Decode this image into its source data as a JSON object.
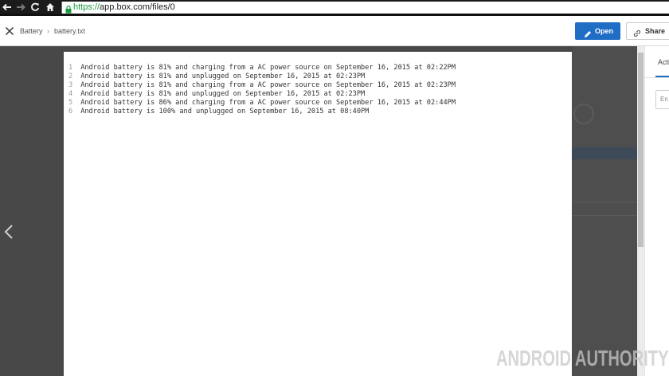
{
  "browser": {
    "url_scheme": "https://",
    "url_rest": "app.box.com/files/0"
  },
  "header": {
    "breadcrumb_folder": "Battery",
    "breadcrumb_separator": "›",
    "breadcrumb_file": "battery.txt",
    "open_label": "Open",
    "share_label": "Share"
  },
  "document": {
    "lines": [
      {
        "num": "1",
        "text": "Android battery is 81% and charging from a AC power source on September 16, 2015 at 02:22PM"
      },
      {
        "num": "2",
        "text": "Android battery is 81% and unplugged on September 16, 2015 at 02:23PM"
      },
      {
        "num": "3",
        "text": "Android battery is 81% and charging from a AC power source on September 16, 2015 at 02:23PM"
      },
      {
        "num": "4",
        "text": "Android battery is 81% and unplugged on September 16, 2015 at 02:23PM"
      },
      {
        "num": "5",
        "text": "Android battery is 86% and charging from a AC power source on September 16, 2015 at 02:44PM"
      },
      {
        "num": "6",
        "text": "Android battery is 100% and unplugged on September 16, 2015 at 08:40PM"
      }
    ]
  },
  "sidebar": {
    "tab_label": "Acti",
    "input_placeholder": "En"
  },
  "watermark": {
    "text": "ANDROID AUTHORITY"
  },
  "colors": {
    "accent": "#1f6dc5",
    "overlay": "#484848",
    "secure_green": "#1a9b3d"
  }
}
